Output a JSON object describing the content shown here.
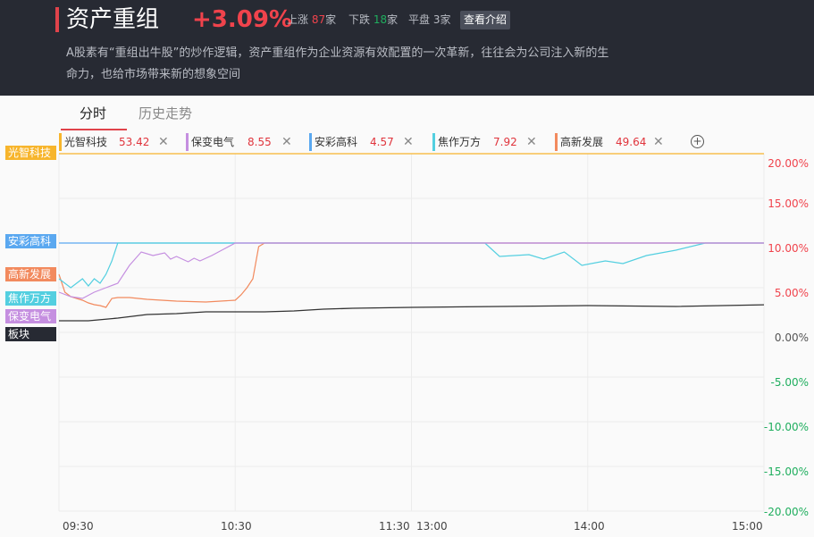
{
  "header": {
    "title": "资产重组",
    "change_pct": "+3.09%",
    "up_label": "上涨",
    "up_count": "87",
    "up_unit": "家",
    "down_label": "下跌",
    "down_count": "18",
    "down_unit": "家",
    "flat_label": "平盘",
    "flat_count": "3",
    "flat_unit": "家",
    "intro_button": "查看介绍",
    "description": "A股素有“重组出牛股”的炒作逻辑，资产重组作为企业资源有效配置的一次革新，往往会为公司注入新的生命力，也给市场带来新的想象空间"
  },
  "tabs": [
    {
      "label": "分时",
      "active": true
    },
    {
      "label": "历史走势",
      "active": false
    }
  ],
  "stock_tags": [
    {
      "name": "光智科技",
      "value": "53.42",
      "color": "#f7b52c"
    },
    {
      "name": "保变电气",
      "value": "8.55",
      "color": "#c58fe0"
    },
    {
      "name": "安彩高科",
      "value": "4.57",
      "color": "#5aa8f0"
    },
    {
      "name": "焦作万方",
      "value": "7.92",
      "color": "#53cfe0"
    },
    {
      "name": "高新发展",
      "value": "49.64",
      "color": "#f28a5e"
    }
  ],
  "add_icon": "plus-circle-icon",
  "close_icon": "close-icon",
  "colors": {
    "up": "#f0434c",
    "down": "#1fae5e",
    "sector_line": "#333333"
  },
  "chart_data": {
    "type": "line",
    "y_unit": "%",
    "ylim": [
      -20,
      20
    ],
    "yticks": [
      "20.00%",
      "15.00%",
      "10.00%",
      "5.00%",
      "0.00%",
      "-5.00%",
      "-10.00%",
      "-15.00%",
      "-20.00%"
    ],
    "xticks": [
      "09:30",
      "10:30",
      "11:30",
      "13:00",
      "14:00",
      "15:00"
    ],
    "grid": true,
    "legend_position": "left",
    "series": [
      {
        "name": "光智科技",
        "color": "#f7b52c",
        "x": [
          0,
          120,
          240
        ],
        "values": [
          20.0,
          20.0,
          20.0
        ]
      },
      {
        "name": "安彩高科",
        "color": "#5aa8f0",
        "x": [
          0,
          120,
          240
        ],
        "values": [
          10.0,
          10.0,
          10.0
        ]
      },
      {
        "name": "高新发展",
        "color": "#f28a5e",
        "x": [
          0,
          2,
          4,
          6,
          8,
          10,
          12,
          14,
          16,
          18,
          20,
          24,
          30,
          40,
          50,
          60,
          62,
          64,
          66,
          68,
          70,
          240
        ],
        "values": [
          6.5,
          4.5,
          4.0,
          3.8,
          3.6,
          3.3,
          3.1,
          3.0,
          2.8,
          3.8,
          3.9,
          3.9,
          3.7,
          3.5,
          3.4,
          3.6,
          4.2,
          5.0,
          6.0,
          9.6,
          10.0,
          10.0
        ]
      },
      {
        "name": "焦作万方",
        "color": "#53cfe0",
        "x": [
          0,
          4,
          8,
          10,
          12,
          14,
          16,
          18,
          20,
          22,
          24,
          28,
          30,
          40,
          120,
          145,
          150,
          160,
          165,
          172,
          178,
          186,
          192,
          200,
          210,
          220,
          226,
          240
        ],
        "values": [
          6.0,
          5.0,
          6.0,
          5.2,
          6.0,
          5.5,
          6.5,
          8.0,
          10.0,
          10.0,
          10.0,
          10.0,
          10.0,
          10.0,
          10.0,
          10.0,
          8.5,
          8.7,
          8.2,
          9.0,
          7.5,
          8.0,
          7.7,
          8.6,
          9.2,
          10.0,
          10.0,
          10.0
        ]
      },
      {
        "name": "保变电气",
        "color": "#c58fe0",
        "x": [
          0,
          4,
          8,
          12,
          16,
          20,
          24,
          28,
          32,
          36,
          38,
          40,
          44,
          46,
          48,
          52,
          56,
          60,
          240
        ],
        "values": [
          4.5,
          4.0,
          3.8,
          4.5,
          5.0,
          5.5,
          7.5,
          9.0,
          8.6,
          8.9,
          8.2,
          8.5,
          7.9,
          8.3,
          8.0,
          8.6,
          9.3,
          10.0,
          10.0
        ]
      },
      {
        "name": "板块",
        "color": "#333333",
        "x": [
          0,
          10,
          20,
          30,
          40,
          50,
          60,
          70,
          80,
          90,
          100,
          120,
          150,
          180,
          210,
          240
        ],
        "values": [
          1.3,
          1.3,
          1.6,
          2.0,
          2.1,
          2.3,
          2.3,
          2.3,
          2.4,
          2.6,
          2.7,
          2.8,
          2.9,
          3.0,
          2.9,
          3.09
        ]
      }
    ]
  }
}
